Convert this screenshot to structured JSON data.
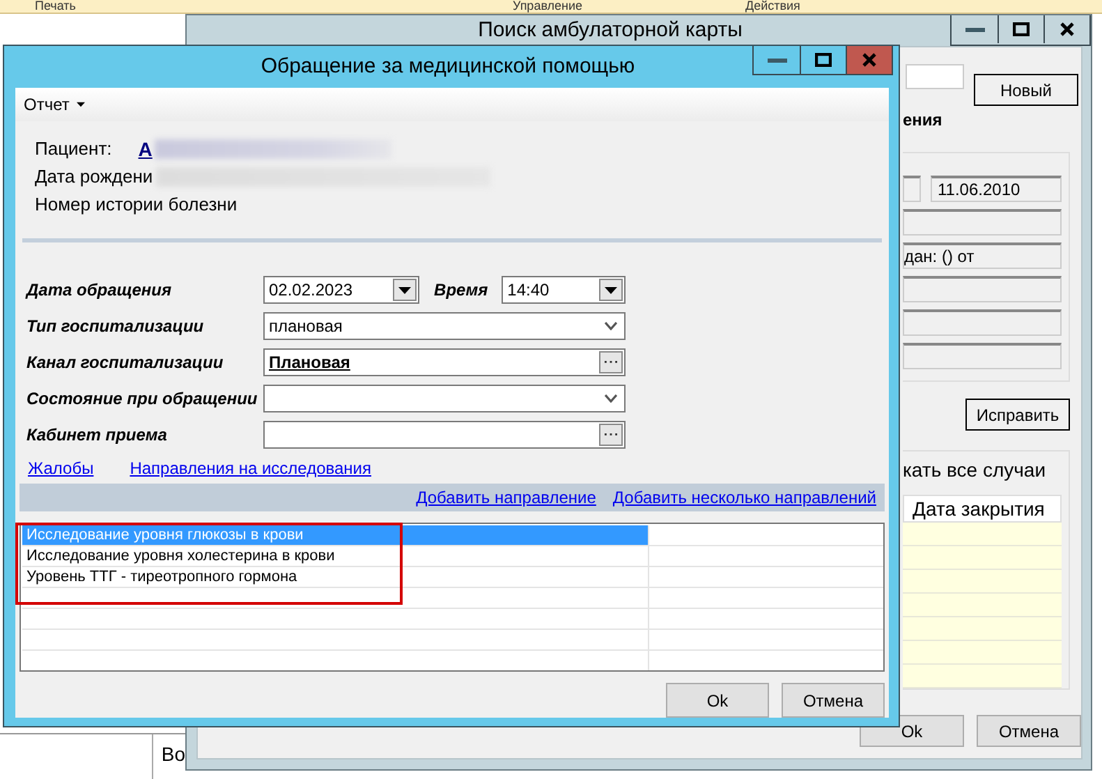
{
  "background_app": {
    "columns": [
      "Печать",
      "Управление",
      "Действия"
    ],
    "cell": "Во"
  },
  "search_window": {
    "title": "Поиск амбулаторной карты",
    "new_button": "Новый",
    "section_label": "ения",
    "date_value": "11.06.2010",
    "issued_text": "дан: () от",
    "edit_button": "Исправить",
    "show_all_text": "кать все случаи",
    "table_columns": [
      "Дата закрытия"
    ],
    "buttons": [
      "Ok",
      "Отмена"
    ]
  },
  "dialog": {
    "title": "Обращение за медицинской помощью",
    "menu": [
      "Отчет"
    ],
    "patient_label": "Пациент:",
    "patient_name": "А",
    "birth_label": "Дата рождени",
    "history_label": "Номер истории болезни",
    "form": [
      {
        "kind": "date",
        "label": "Дата обращения",
        "value": "02.02.2023",
        "time_label": "Время",
        "time_value": "14:40"
      },
      {
        "kind": "combo",
        "label": "Тип госпитализации",
        "value": "плановая"
      },
      {
        "kind": "lookup",
        "label": "Канал госпитализации",
        "value": "Плановая"
      },
      {
        "kind": "combo",
        "label": "Состояние при обращении"
      },
      {
        "kind": "lookup",
        "label": "Кабинет приема"
      }
    ],
    "links": [
      "Жалобы",
      "Направления на исследования"
    ],
    "actions": [
      "Добавить направление",
      "Добавить несколько направлений"
    ],
    "referrals": [
      {
        "name": "Исследование уровня глюкозы в крови",
        "selected": true
      },
      {
        "name": "Исследование уровня холестерина в крови",
        "selected": false
      },
      {
        "name": "Уровень ТТГ - тиреотропного гормона",
        "selected": false
      }
    ],
    "buttons": [
      "Ok",
      "Отмена"
    ]
  }
}
